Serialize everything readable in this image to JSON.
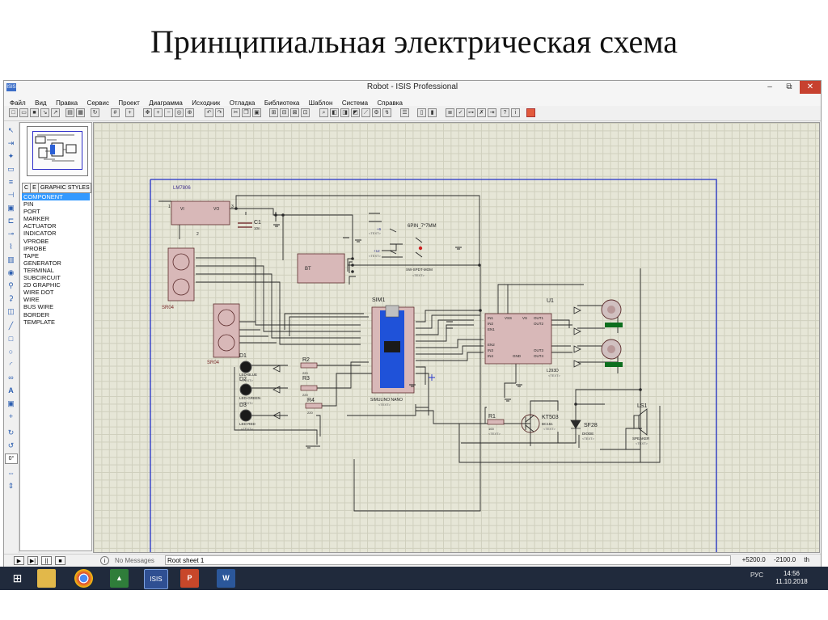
{
  "slide": {
    "title": "Принципиальная электрическая схема"
  },
  "window": {
    "title": "Robot - ISIS Professional",
    "app_badge": "ISIS",
    "controls": {
      "minimize": "‒",
      "restore": "⧉",
      "close": "✕"
    }
  },
  "menu": [
    "Файл",
    "Вид",
    "Правка",
    "Сервис",
    "Проект",
    "Диаграмма",
    "Исходник",
    "Отладка",
    "Библиотека",
    "Шаблон",
    "Система",
    "Справка"
  ],
  "panel": {
    "tab_c": "C",
    "tab_e": "E",
    "header": "GRAPHIC STYLES",
    "modes": [
      "COMPONENT",
      "PIN",
      "PORT",
      "MARKER",
      "ACTUATOR",
      "INDICATOR",
      "VPROBE",
      "IPROBE",
      "TAPE",
      "GENERATOR",
      "TERMINAL",
      "SUBCIRCUIT",
      "2D GRAPHIC",
      "WIRE DOT",
      "WIRE",
      "BUS WIRE",
      "BORDER",
      "TEMPLATE"
    ],
    "selected": "COMPONENT",
    "rotation": "0°"
  },
  "schematic": {
    "labels": {
      "lm7806": "LM7806",
      "vi": "VI",
      "vo": "VO",
      "gnd": "GND",
      "p1": "1",
      "p2": "2",
      "p3": "3",
      "c1": "C1",
      "c1val": "10n",
      "sw": "6PIN_7*7MM",
      "v6": "+6",
      "v12": "+12",
      "swpart": "SW-SPDT-MOM",
      "bt": "BT",
      "sim1": "SIM1",
      "nano": "SIMULINO NANO",
      "u1": "U1",
      "l293": "L293D",
      "in1": "IN1",
      "in2": "IN2",
      "en1": "EN1",
      "en2": "EN2",
      "in3": "IN3",
      "in4": "IN4",
      "vss": "VSS",
      "vs": "VS",
      "out1": "OUT1",
      "out2": "OUT2",
      "out3": "OUT3",
      "out4": "OUT4",
      "gnd2": "GND",
      "sr04a": "SR04",
      "sr04b": "SR04",
      "d1": "D1",
      "d2": "D2",
      "d3": "D3",
      "led1": "LED-BLUE",
      "led2": "LED-GREEN",
      "led3": "LED-RED",
      "r2": "R2",
      "r3": "R3",
      "r4": "R4",
      "r1": "R1",
      "r2v": "220",
      "r3v": "220",
      "r4v": "220",
      "r1v": "100",
      "kt503": "KT503",
      "bc": "BC161",
      "sf28": "SF28",
      "diode": "DIODE",
      "ls1": "LS1",
      "speaker": "SPEAKER",
      "text": "<TEXT>"
    }
  },
  "status": {
    "messages": "No Messages",
    "sheet": "Root sheet 1",
    "x": "+5200.0",
    "y": "-2100.0",
    "unit": "th"
  },
  "taskbar": {
    "apps": [
      "Windows",
      "Проводник",
      "Chrome",
      "Proteus ARES",
      "ISIS",
      "PowerPoint",
      "Word"
    ],
    "lang": "РУС",
    "time": "14:56",
    "date": "11.10.2018"
  }
}
